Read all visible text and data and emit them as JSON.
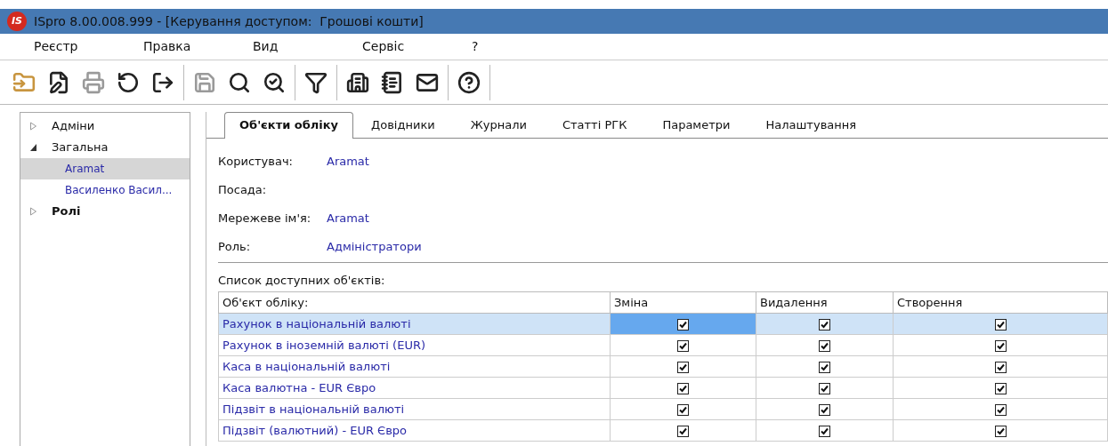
{
  "window": {
    "logo": "IS",
    "title": "ISpro 8.00.008.999 - [Керування доступом:  Грошові кошти]"
  },
  "menu": [
    "Реєстр",
    "Правка",
    "Вид",
    "Сервіс",
    "?"
  ],
  "toolbar": [
    [
      {
        "kind": "open",
        "disabled": false
      },
      {
        "kind": "edit",
        "disabled": false
      },
      {
        "kind": "print",
        "disabled": true
      },
      {
        "kind": "refresh",
        "disabled": false
      },
      {
        "kind": "exit",
        "disabled": false
      }
    ],
    [
      {
        "kind": "save",
        "disabled": true
      },
      {
        "kind": "search",
        "disabled": false
      },
      {
        "kind": "search-next",
        "disabled": false
      }
    ],
    [
      {
        "kind": "filter",
        "disabled": false
      }
    ],
    [
      {
        "kind": "building",
        "disabled": false
      },
      {
        "kind": "notebook",
        "disabled": false
      },
      {
        "kind": "mail",
        "disabled": false
      }
    ],
    [
      {
        "kind": "help",
        "disabled": false
      }
    ]
  ],
  "tree": [
    {
      "label": "Адміни",
      "bold": false,
      "expanded": false,
      "selected": false
    },
    {
      "label": "Загальна",
      "bold": false,
      "expanded": true,
      "selected": false,
      "children": [
        {
          "label": "Aramat",
          "selected": true
        },
        {
          "label": "Василенко Васил...",
          "selected": false
        }
      ]
    },
    {
      "label": "Ролі",
      "bold": true,
      "expanded": false,
      "selected": false
    }
  ],
  "tabs": [
    {
      "label": "Об'єкти обліку",
      "selected": true
    },
    {
      "label": "Довідники",
      "selected": false
    },
    {
      "label": "Журнали",
      "selected": false
    },
    {
      "label": "Статті РГК",
      "selected": false
    },
    {
      "label": "Параметри",
      "selected": false
    },
    {
      "label": "Налаштування",
      "selected": false
    }
  ],
  "fields": [
    {
      "label": "Користувач:",
      "value": "Aramat"
    },
    {
      "label": "Посада:"
    },
    {
      "label": "Мережеве ім'я:",
      "value": "Aramat"
    },
    {
      "label": "Роль:",
      "value": "Адміністратори"
    }
  ],
  "list_title": "Список доступних об'єктів:",
  "table": {
    "columns": [
      "Об'єкт обліку:",
      "Зміна",
      "Видалення",
      "Створення"
    ],
    "rows": [
      {
        "name": "Рахунок в національній валюті",
        "selected": true,
        "change": true,
        "delete": true,
        "create": true
      },
      {
        "name": "Рахунок в іноземній валюті (EUR)",
        "selected": false,
        "change": true,
        "delete": true,
        "create": true
      },
      {
        "name": "Каса в національній валюті",
        "selected": false,
        "change": true,
        "delete": true,
        "create": true
      },
      {
        "name": "Каса валютна - EUR Євро",
        "selected": false,
        "change": true,
        "delete": true,
        "create": true
      },
      {
        "name": "Підзвіт в національній валюті",
        "selected": false,
        "change": true,
        "delete": true,
        "create": true
      },
      {
        "name": "Підзвіт (валютний) - EUR Євро",
        "selected": false,
        "change": true,
        "delete": true,
        "create": true
      }
    ]
  }
}
